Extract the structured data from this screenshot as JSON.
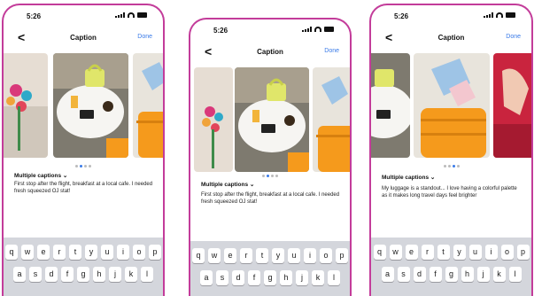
{
  "screens": [
    {
      "time": "5:26",
      "nav": {
        "back": "<",
        "title": "Caption",
        "done": "Done"
      },
      "multiple_captions": "Multiple captions ⌄",
      "caption": "First stop after the flight, breakfast at a local cafe. I needed fresh squeezed OJ stat!",
      "active_dot": 1,
      "keyboard_rows": [
        [
          "q",
          "w",
          "e",
          "r",
          "t",
          "y",
          "u",
          "i",
          "o",
          "p"
        ],
        [
          "a",
          "s",
          "d",
          "f",
          "g",
          "h",
          "j",
          "k",
          "l"
        ]
      ]
    },
    {
      "time": "5:26",
      "nav": {
        "back": "<",
        "title": "Caption",
        "done": "Done"
      },
      "multiple_captions": "Multiple captions ⌄",
      "caption": "First stop after the flight, breakfast at a local cafe. I needed fresh squeezed OJ stat!",
      "active_dot": 1,
      "keyboard_rows": [
        [
          "q",
          "w",
          "e",
          "r",
          "t",
          "y",
          "u",
          "i",
          "o",
          "p"
        ],
        [
          "a",
          "s",
          "d",
          "f",
          "g",
          "h",
          "j",
          "k",
          "l"
        ]
      ]
    },
    {
      "time": "5:26",
      "nav": {
        "back": "<",
        "title": "Caption",
        "done": "Done"
      },
      "multiple_captions": "Multiple captions ⌄",
      "caption": "My luggage is a standout... I love having a colorful palette as it makes long travel days feel brighter",
      "active_dot": 2,
      "keyboard_rows": [
        [
          "q",
          "w",
          "e",
          "r",
          "t",
          "y",
          "u",
          "i",
          "o",
          "p"
        ],
        [
          "a",
          "s",
          "d",
          "f",
          "g",
          "h",
          "j",
          "k",
          "l"
        ]
      ]
    }
  ],
  "colors": {
    "frame": "#c33c9a",
    "accent": "#3a7be8",
    "keyboard": "#d4d6dc"
  }
}
